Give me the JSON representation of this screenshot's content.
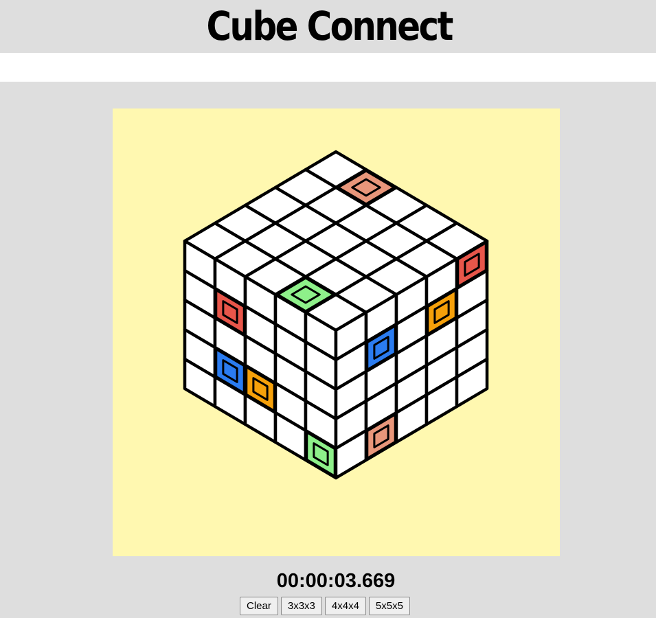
{
  "header": {
    "title": "Cube Connect"
  },
  "game": {
    "grid_size": 5,
    "timer": "00:00:03.669",
    "colors": {
      "salmon": "#e8967a",
      "red": "#e8564a",
      "green": "#8ef08a",
      "blue": "#2b7cf0",
      "orange": "#f5a00a",
      "cell": "#ffffff",
      "grid_line": "#000000",
      "board_bg": "#fff8b0"
    },
    "endpoints": [
      {
        "face": "top",
        "row": 0,
        "col": 1,
        "color": "salmon"
      },
      {
        "face": "top",
        "row": 4,
        "col": 3,
        "color": "green"
      },
      {
        "face": "left",
        "row": 1,
        "col": 1,
        "color": "red"
      },
      {
        "face": "left",
        "row": 3,
        "col": 1,
        "color": "blue"
      },
      {
        "face": "left",
        "row": 3,
        "col": 2,
        "color": "orange"
      },
      {
        "face": "left",
        "row": 4,
        "col": 4,
        "color": "green"
      },
      {
        "face": "right",
        "row": 0,
        "col": 4,
        "color": "red"
      },
      {
        "face": "right",
        "row": 1,
        "col": 1,
        "color": "blue"
      },
      {
        "face": "right",
        "row": 1,
        "col": 3,
        "color": "orange"
      },
      {
        "face": "right",
        "row": 4,
        "col": 1,
        "color": "salmon"
      }
    ]
  },
  "controls": {
    "clear_label": "Clear",
    "size3_label": "3x3x3",
    "size4_label": "4x4x4",
    "size5_label": "5x5x5"
  }
}
